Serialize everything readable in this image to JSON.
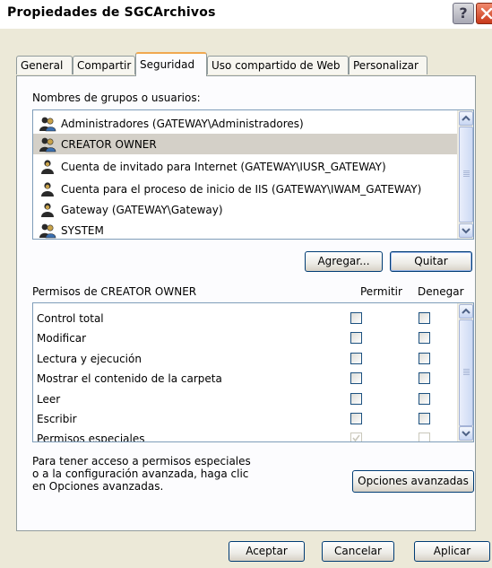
{
  "window": {
    "title": "Propiedades de SGCArchivos",
    "help_label": "?"
  },
  "tabs": [
    "General",
    "Compartir",
    "Seguridad",
    "Uso compartido de Web",
    "Personalizar"
  ],
  "active_tab": "Seguridad",
  "groups": {
    "label": "Nombres de grupos o usuarios:",
    "items": [
      "Administradores (GATEWAY\\Administradores)",
      "CREATOR OWNER",
      "Cuenta de invitado para Internet (GATEWAY\\IUSR_GATEWAY)",
      "Cuenta para el proceso de inicio de IIS (GATEWAY\\IWAM_GATEWAY)",
      "Gateway (GATEWAY\\Gateway)",
      "SYSTEM"
    ],
    "selected": "CREATOR OWNER",
    "add_label": "Agregar...",
    "remove_label": "Quitar"
  },
  "permissions": {
    "header": "Permisos de CREATOR OWNER",
    "allow_label": "Permitir",
    "deny_label": "Denegar",
    "rows": [
      {
        "name": "Control total",
        "allow": false,
        "deny": false
      },
      {
        "name": "Modificar",
        "allow": false,
        "deny": false
      },
      {
        "name": "Lectura y ejecución",
        "allow": false,
        "deny": false
      },
      {
        "name": "Mostrar el contenido de la carpeta",
        "allow": false,
        "deny": false
      },
      {
        "name": "Leer",
        "allow": false,
        "deny": false
      },
      {
        "name": "Escribir",
        "allow": false,
        "deny": false
      },
      {
        "name": "Permisos especiales",
        "allow": true,
        "deny": false
      }
    ]
  },
  "advanced": {
    "text_line1": "Para tener acceso a permisos especiales",
    "text_line2": "o a la configuración avanzada, haga clic",
    "text_line3": "en Opciones avanzadas.",
    "button_label": "Opciones avanzadas"
  },
  "footer": {
    "ok_label": "Aceptar",
    "cancel_label": "Cancelar",
    "apply_label": "Aplicar"
  }
}
